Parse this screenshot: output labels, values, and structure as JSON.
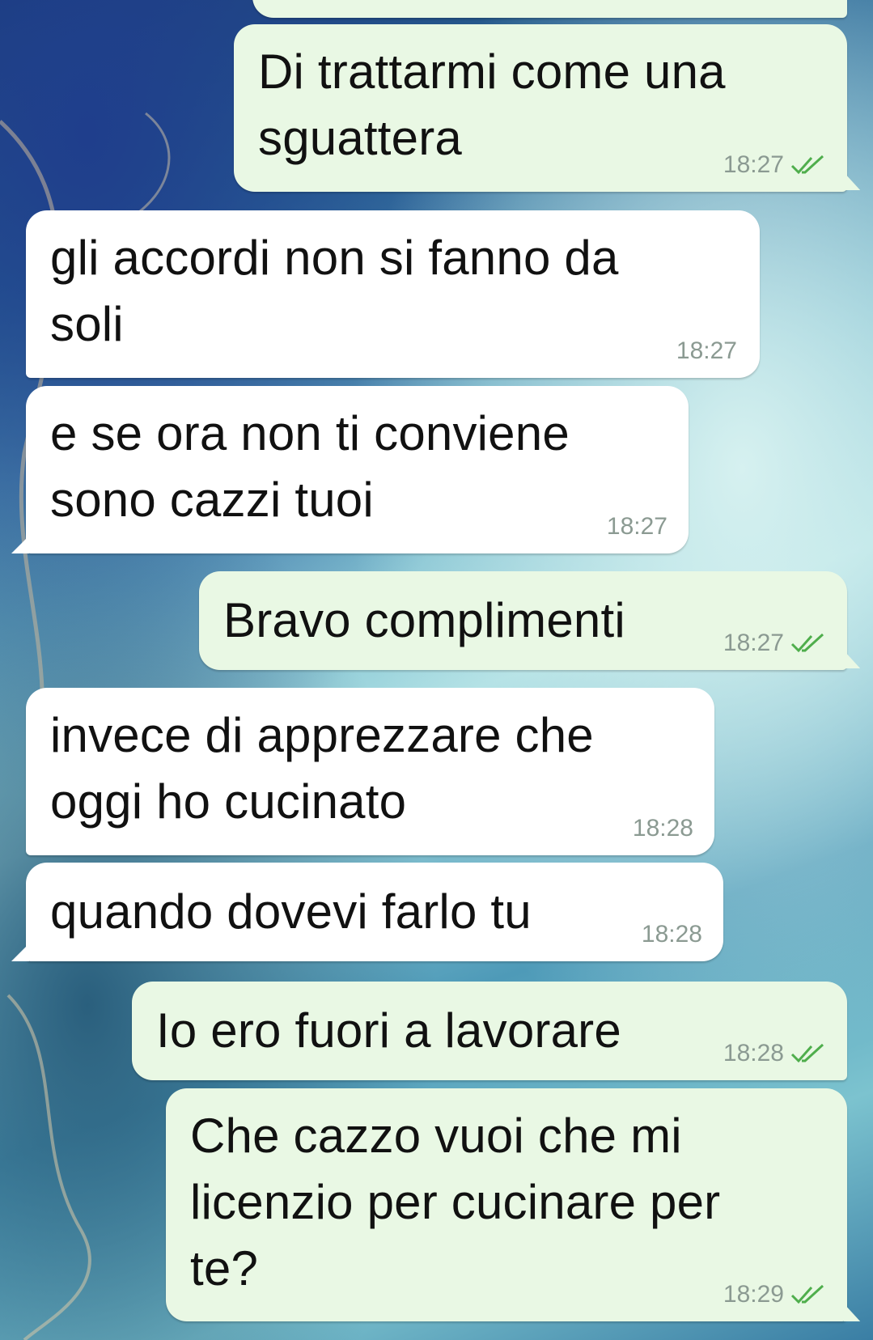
{
  "messages": [
    {
      "direction": "out",
      "text": "Di trattarmi come una\nsguattera",
      "time": "18:27",
      "status_icon": "double-check-icon"
    },
    {
      "direction": "in",
      "text": "gli accordi non si fanno da\nsoli",
      "time": "18:27"
    },
    {
      "direction": "in",
      "text": "e se ora non ti conviene\nsono cazzi tuoi",
      "time": "18:27"
    },
    {
      "direction": "out",
      "text": "Bravo complimenti",
      "time": "18:27",
      "status_icon": "double-check-icon"
    },
    {
      "direction": "in",
      "text": "invece di apprezzare che\noggi ho cucinato",
      "time": "18:28"
    },
    {
      "direction": "in",
      "text": "quando dovevi farlo tu",
      "time": "18:28"
    },
    {
      "direction": "out",
      "text": "Io ero fuori a lavorare",
      "time": "18:28",
      "status_icon": "double-check-icon"
    },
    {
      "direction": "out",
      "text": "Che cazzo vuoi che mi\nlicenzio per cucinare per\nte?",
      "time": "18:29",
      "status_icon": "double-check-icon"
    }
  ],
  "colors": {
    "incoming_bubble": "#ffffff",
    "outgoing_bubble": "#e9f8e4",
    "read_check": "#4fae4c",
    "timestamp": "#8b9a92"
  }
}
